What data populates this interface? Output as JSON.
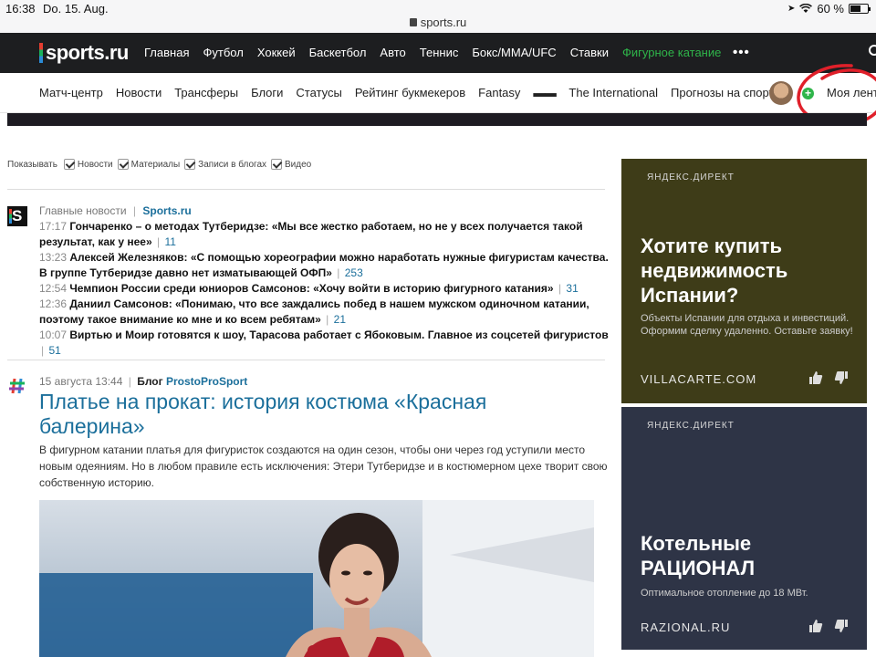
{
  "status_bar": {
    "time": "16:38",
    "date": "Do. 15. Aug.",
    "url": "sports.ru",
    "battery": "60 %",
    "battery_level": 0.6
  },
  "top_nav": {
    "logo": "sports.ru",
    "items": [
      {
        "label": "Главная"
      },
      {
        "label": "Футбол"
      },
      {
        "label": "Хоккей"
      },
      {
        "label": "Баскетбол"
      },
      {
        "label": "Авто"
      },
      {
        "label": "Теннис"
      },
      {
        "label": "Бокс/MMA/UFC"
      },
      {
        "label": "Ставки"
      },
      {
        "label": "Фигурное катание",
        "active": true
      }
    ],
    "more": "•••"
  },
  "sub_nav": {
    "items": [
      "Матч-центр",
      "Новости",
      "Трансферы",
      "Блоги",
      "Статусы",
      "Рейтинг букмекеров",
      "Fantasy"
    ],
    "ti_badge": "ꟷꟷꟷ",
    "ti_label": "The International",
    "forecasts": "Прогнозы на спорт",
    "my_feed": "Моя лента"
  },
  "filters": {
    "show_label": "Показывать",
    "options": [
      "Новости",
      "Материалы",
      "Записи в блогах",
      "Видео"
    ]
  },
  "news": {
    "heading": "Главные новости",
    "source": "Sports.ru",
    "items": [
      {
        "time": "17:17",
        "title": "Гончаренко – о методах Тутберидзе: «Мы все жестко работаем, но не у всех получается такой результат, как у нее»",
        "comments": "11"
      },
      {
        "time": "13:23",
        "title": "Алексей Железняков: «С помощью хореографии можно наработать нужные фигуристам качества. В группе Тутберидзе давно нет изматывающей ОФП»",
        "comments": "253"
      },
      {
        "time": "12:54",
        "title": "Чемпион России среди юниоров Самсонов: «Хочу войти в историю фигурного катания»",
        "comments": "31"
      },
      {
        "time": "12:36",
        "title": "Даниил Самсонов: «Понимаю, что все заждались побед в нашем мужском одиночном катании, поэтому такое внимание ко мне и ко всем ребятам»",
        "comments": "21"
      },
      {
        "time": "10:07",
        "title": "Виртью и Моир готовятся к шоу, Тарасова работает с Ябоковым. Главное из соцсетей фигуристов",
        "comments": "51"
      }
    ]
  },
  "article": {
    "date": "15 августа 13:44",
    "blog_label": "Блог",
    "blog_name": "ProstoProSport",
    "title": "Платье на прокат: история костюма «Красная балерина»",
    "lead": "В фигурном катании платья для фигуристок создаются на один сезон, чтобы они через год уступили место новым одеяниям. Но в любом правиле есть исключения: Этери Тутберидзе и в костюмерном цехе творит свою собственную историю."
  },
  "ads": [
    {
      "label": "ЯНДЕКС.ДИРЕКТ",
      "title": "Хотите купить недвижимость Испании?",
      "desc": "Объекты Испании для отдыха и инвестиций. Оформим сделку удаленно. Оставьте заявку!",
      "domain": "VILLACARTE.COM",
      "bg": "#3e3c18"
    },
    {
      "label": "ЯНДЕКС.ДИРЕКТ",
      "title": "Котельные РАЦИОНАЛ",
      "desc": "Оптимальное отопление до 18 МВт.",
      "domain": "RAZIONAL.RU",
      "bg": "#2e3446"
    }
  ],
  "colors": {
    "accent_green": "#2fb54a",
    "link_blue": "#1b6f9b",
    "nav_dark": "#1d1e20",
    "annotation_red": "#e0202a"
  }
}
